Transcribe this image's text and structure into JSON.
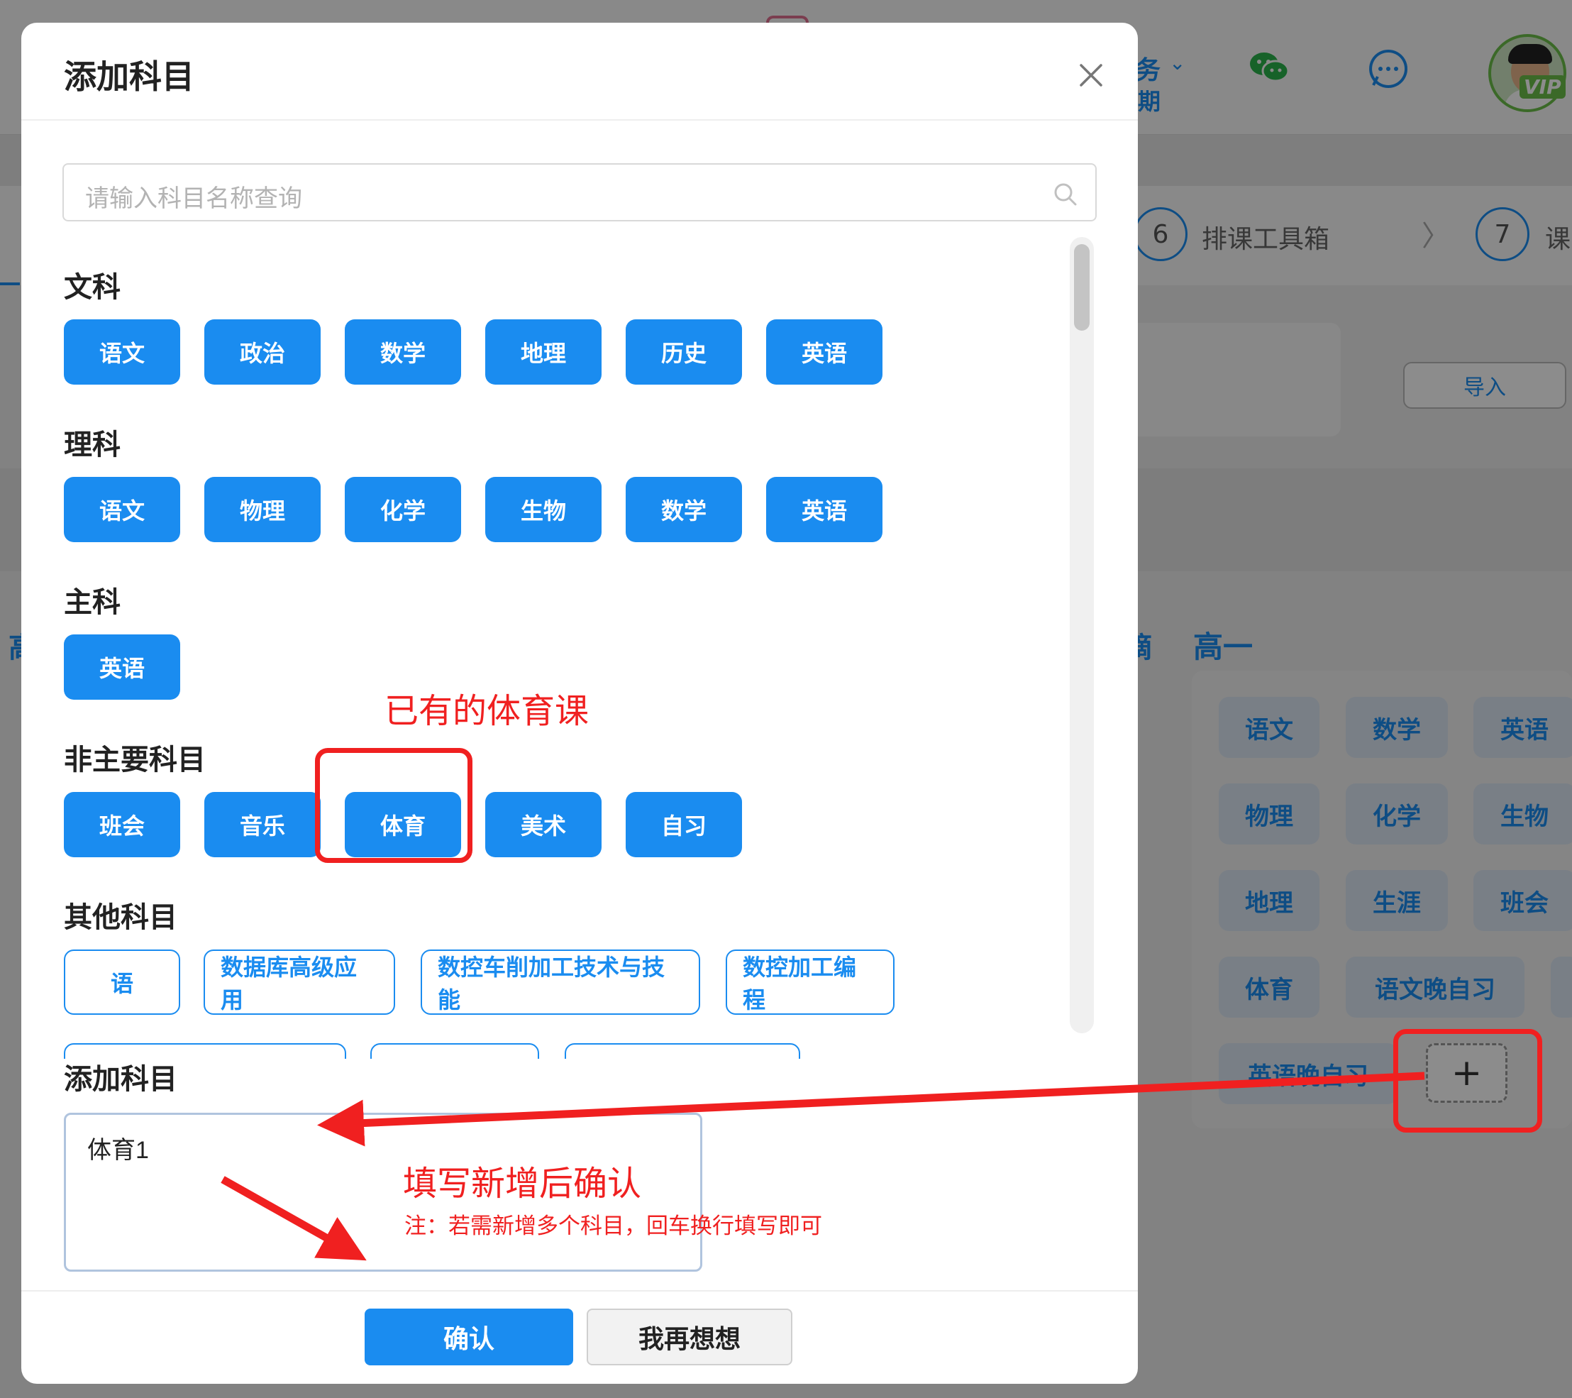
{
  "background": {
    "header_task_text": "务",
    "header_term_text": "期",
    "steps": [
      {
        "number": "6",
        "label": "排课工具箱"
      },
      {
        "number": "7",
        "label": "课"
      }
    ],
    "import_button": "导入",
    "left_fragment": "高",
    "grade_label": "高一",
    "grade_left_fragment": "摘",
    "subject_tags": [
      "语文",
      "数学",
      "英语",
      "物理",
      "化学",
      "生物",
      "地理",
      "生涯",
      "班会",
      "体育",
      "语文晚自习",
      "英语晚自习"
    ],
    "vip_badge": "VIP",
    "plus_symbol": "+"
  },
  "modal": {
    "title": "添加科目",
    "search_placeholder": "请输入科目名称查询",
    "sections": [
      {
        "title": "文科",
        "tags": [
          "语文",
          "政治",
          "数学",
          "地理",
          "历史",
          "英语"
        ]
      },
      {
        "title": "理科",
        "tags": [
          "语文",
          "物理",
          "化学",
          "生物",
          "数学",
          "英语"
        ]
      },
      {
        "title": "主科",
        "tags": [
          "英语"
        ]
      },
      {
        "title": "非主要科目",
        "tags": [
          "班会",
          "音乐",
          "体育",
          "美术",
          "自习"
        ]
      },
      {
        "title": "其他科目",
        "tags": [
          "语",
          "数据库高级应用",
          "数控车削加工技术与技能",
          "数控加工编程"
        ]
      }
    ],
    "add_section_title": "添加科目",
    "add_input_value": "体育1",
    "confirm_button": "确认",
    "cancel_button": "我再想想"
  },
  "annotations": {
    "existing_pe_label": "已有的体育课",
    "fill_confirm_label": "填写新增后确认",
    "note": "注：若需新增多个科目，回车换行填写即可"
  },
  "colors": {
    "primary": "#1a8cf0",
    "annotation_red": "#f02020"
  }
}
